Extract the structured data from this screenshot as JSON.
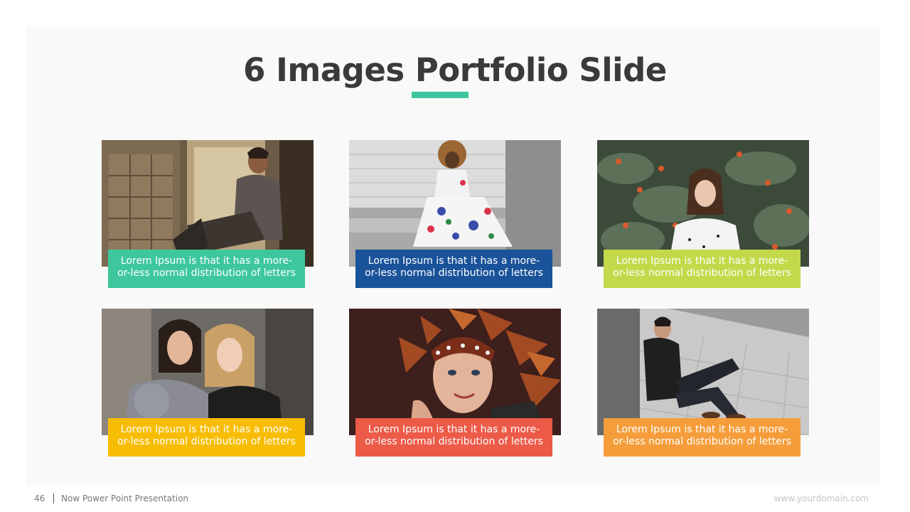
{
  "slide": {
    "title": "6 Images Portfolio Slide",
    "accent_color": "#3dc6a0"
  },
  "cards": [
    {
      "caption": "Lorem Ipsum is that it has a more-or-less normal distribution of letters",
      "color": "#3ec79d",
      "photo": "man-sitting-by-window"
    },
    {
      "caption": "Lorem Ipsum is that it has a more-or-less normal distribution of letters",
      "color": "#1a539a",
      "photo": "woman-floral-dress"
    },
    {
      "caption": "Lorem Ipsum is that it has a more-or-less normal distribution of letters",
      "color": "#c3d94a",
      "photo": "woman-in-foliage"
    },
    {
      "caption": "Lorem Ipsum is that it has a more-or-less normal distribution of letters",
      "color": "#f7bd05",
      "photo": "two-women-portrait"
    },
    {
      "caption": "Lorem Ipsum is that it has a more-or-less normal distribution of letters",
      "color": "#ec5a48",
      "photo": "woman-autumn-leaves"
    },
    {
      "caption": "Lorem Ipsum is that it has a more-or-less normal distribution of letters",
      "color": "#f59d3a",
      "photo": "man-sitting-on-sidewalk"
    }
  ],
  "footer": {
    "page_number": "46",
    "presentation_name": "Now Power Point Presentation",
    "website": "www.yourdomain.com"
  }
}
